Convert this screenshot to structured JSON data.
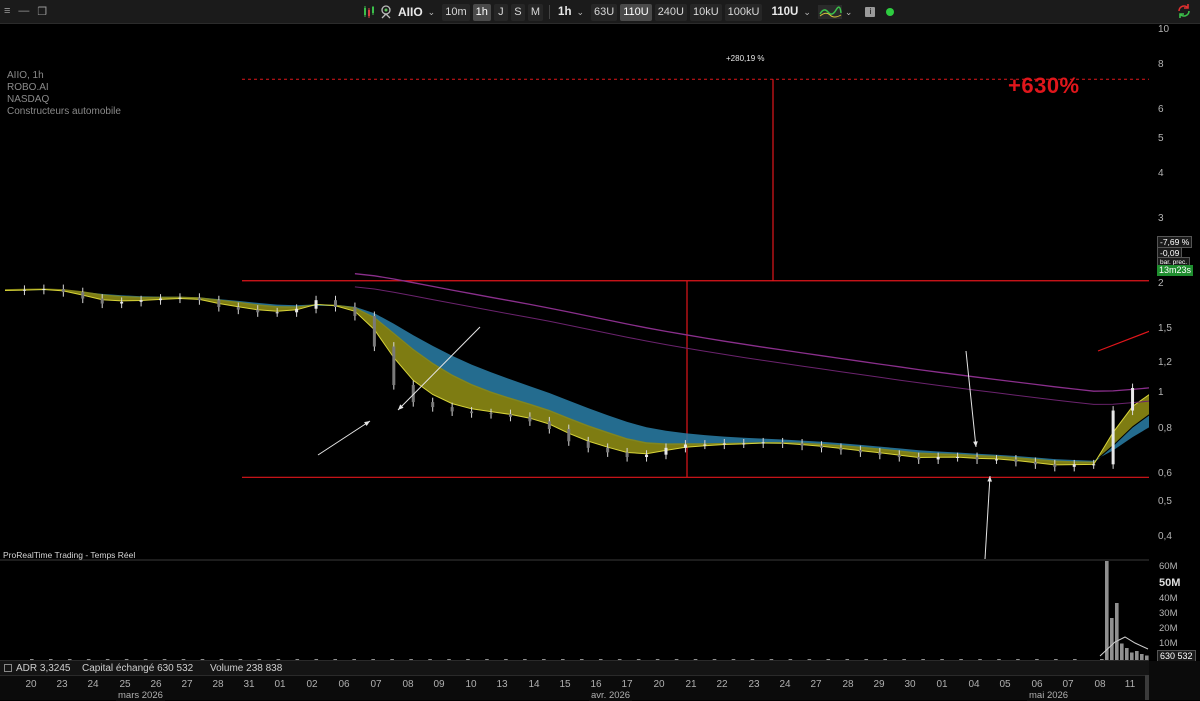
{
  "toolbar": {
    "window_controls": [
      "≡",
      "—",
      "❐"
    ],
    "ticker": "AIIO",
    "chevron": "⌄",
    "timeframes": [
      {
        "label": "10m",
        "active": false
      },
      {
        "label": "1h",
        "active": true
      },
      {
        "label": "J",
        "active": false
      },
      {
        "label": "S",
        "active": false
      },
      {
        "label": "M",
        "active": false
      }
    ],
    "period": "1h",
    "units": [
      {
        "label": "63U",
        "active": false
      },
      {
        "label": "110U",
        "active": true
      },
      {
        "label": "240U",
        "active": false
      },
      {
        "label": "10kU",
        "active": false
      },
      {
        "label": "100kU",
        "active": false
      }
    ],
    "units_selected": "110U",
    "info_icon": "i",
    "icons": [
      "candles-icon",
      "profile-icon",
      "chart-style-icon",
      "info-icon",
      "live-dot",
      "refresh-icon"
    ],
    "live_color": "#2ecc40"
  },
  "instrument": {
    "line1": "AIIO, 1h",
    "line2": "ROBO.AI",
    "line3": "NASDAQ",
    "line4": "Constructeurs automobile"
  },
  "annotations": {
    "big_gain": "+630%",
    "measure": "+280,19 %",
    "provider": "ProRealTime Trading - Temps Réel",
    "accent_red": "#e0161b"
  },
  "price_axis": {
    "ticks": [
      "10",
      "8",
      "6",
      "5",
      "4",
      "3",
      "2",
      "1,5",
      "1,2",
      "1",
      "0,8",
      "0,6",
      "0,5",
      "0,4"
    ],
    "tag_pct": "-7,69 %",
    "tag_change": "-0,09",
    "tag_bar": "bar. prec.",
    "timer": "13m23s"
  },
  "volume_axis": {
    "ticks": [
      "60M",
      "50M",
      "40M",
      "30M",
      "20M",
      "10M"
    ],
    "last": "630 532"
  },
  "stats": {
    "adr_label": "ADR",
    "adr_value": "3,3245",
    "capital_label": "Capital échangé",
    "capital_value": "630 532",
    "volume_label": "Volume",
    "volume_value": "238 838"
  },
  "date_axis": {
    "days": [
      "20",
      "23",
      "24",
      "25",
      "26",
      "27",
      "28",
      "31",
      "01",
      "02",
      "06",
      "07",
      "08",
      "09",
      "10",
      "13",
      "14",
      "15",
      "16",
      "17",
      "20",
      "21",
      "22",
      "23",
      "24",
      "27",
      "28",
      "29",
      "30",
      "01",
      "04",
      "05",
      "06",
      "07",
      "08",
      "11"
    ],
    "months": [
      "mars 2026",
      "avr. 2026",
      "mai 2026"
    ]
  },
  "chart_data": {
    "type": "candlestick",
    "x_label_source": "date_axis.days",
    "ylim": [
      0.37,
      10.5
    ],
    "y_scale": "log",
    "close": [
      1.92,
      1.93,
      1.94,
      1.9,
      1.82,
      1.76,
      1.78,
      1.8,
      1.82,
      1.83,
      1.8,
      1.72,
      1.69,
      1.66,
      1.66,
      1.7,
      1.8,
      1.72,
      1.62,
      1.32,
      1.02,
      0.91,
      0.88,
      0.855,
      0.845,
      0.84,
      0.825,
      0.8,
      0.76,
      0.7,
      0.67,
      0.65,
      0.63,
      0.64,
      0.67,
      0.685,
      0.685,
      0.69,
      0.69,
      0.695,
      0.69,
      0.68,
      0.67,
      0.66,
      0.65,
      0.64,
      0.63,
      0.62,
      0.63,
      0.63,
      0.62,
      0.62,
      0.61,
      0.6,
      0.59,
      0.6,
      0.6,
      0.86,
      1.0,
      1.04
    ],
    "moving_averages": [
      "short MA (yellow)",
      "MA cloud (blue)",
      "long MA (purple)"
    ],
    "horizontal_levels": [
      2.05,
      0.55,
      7.9
    ],
    "measure_move_pct": "+280,19 %",
    "volume_millions": [
      0.3,
      0.2,
      0.25,
      0.2,
      0.15,
      0.3,
      0.2,
      0.15,
      0.4,
      0.3,
      0.6,
      0.5,
      0.3,
      0.3,
      0.2,
      0.3,
      0.2,
      0.2,
      0.3,
      0.2,
      0.1,
      0.2,
      0.2,
      0.15,
      0.2,
      0.1,
      0.15,
      0.1,
      0.1,
      0.2,
      0.1,
      0.3,
      0.1,
      0.1,
      0.1,
      0.1,
      0.1,
      0.3,
      0.1,
      0.1,
      0.1,
      0.1,
      0.1,
      0.1,
      0.1,
      0.1,
      0.1,
      0.1,
      0.1,
      0.1,
      0.1,
      0.1,
      0.1,
      0.1,
      0.1,
      0.1,
      0.5,
      66,
      28,
      38,
      11,
      8,
      5,
      6,
      4,
      3
    ]
  }
}
